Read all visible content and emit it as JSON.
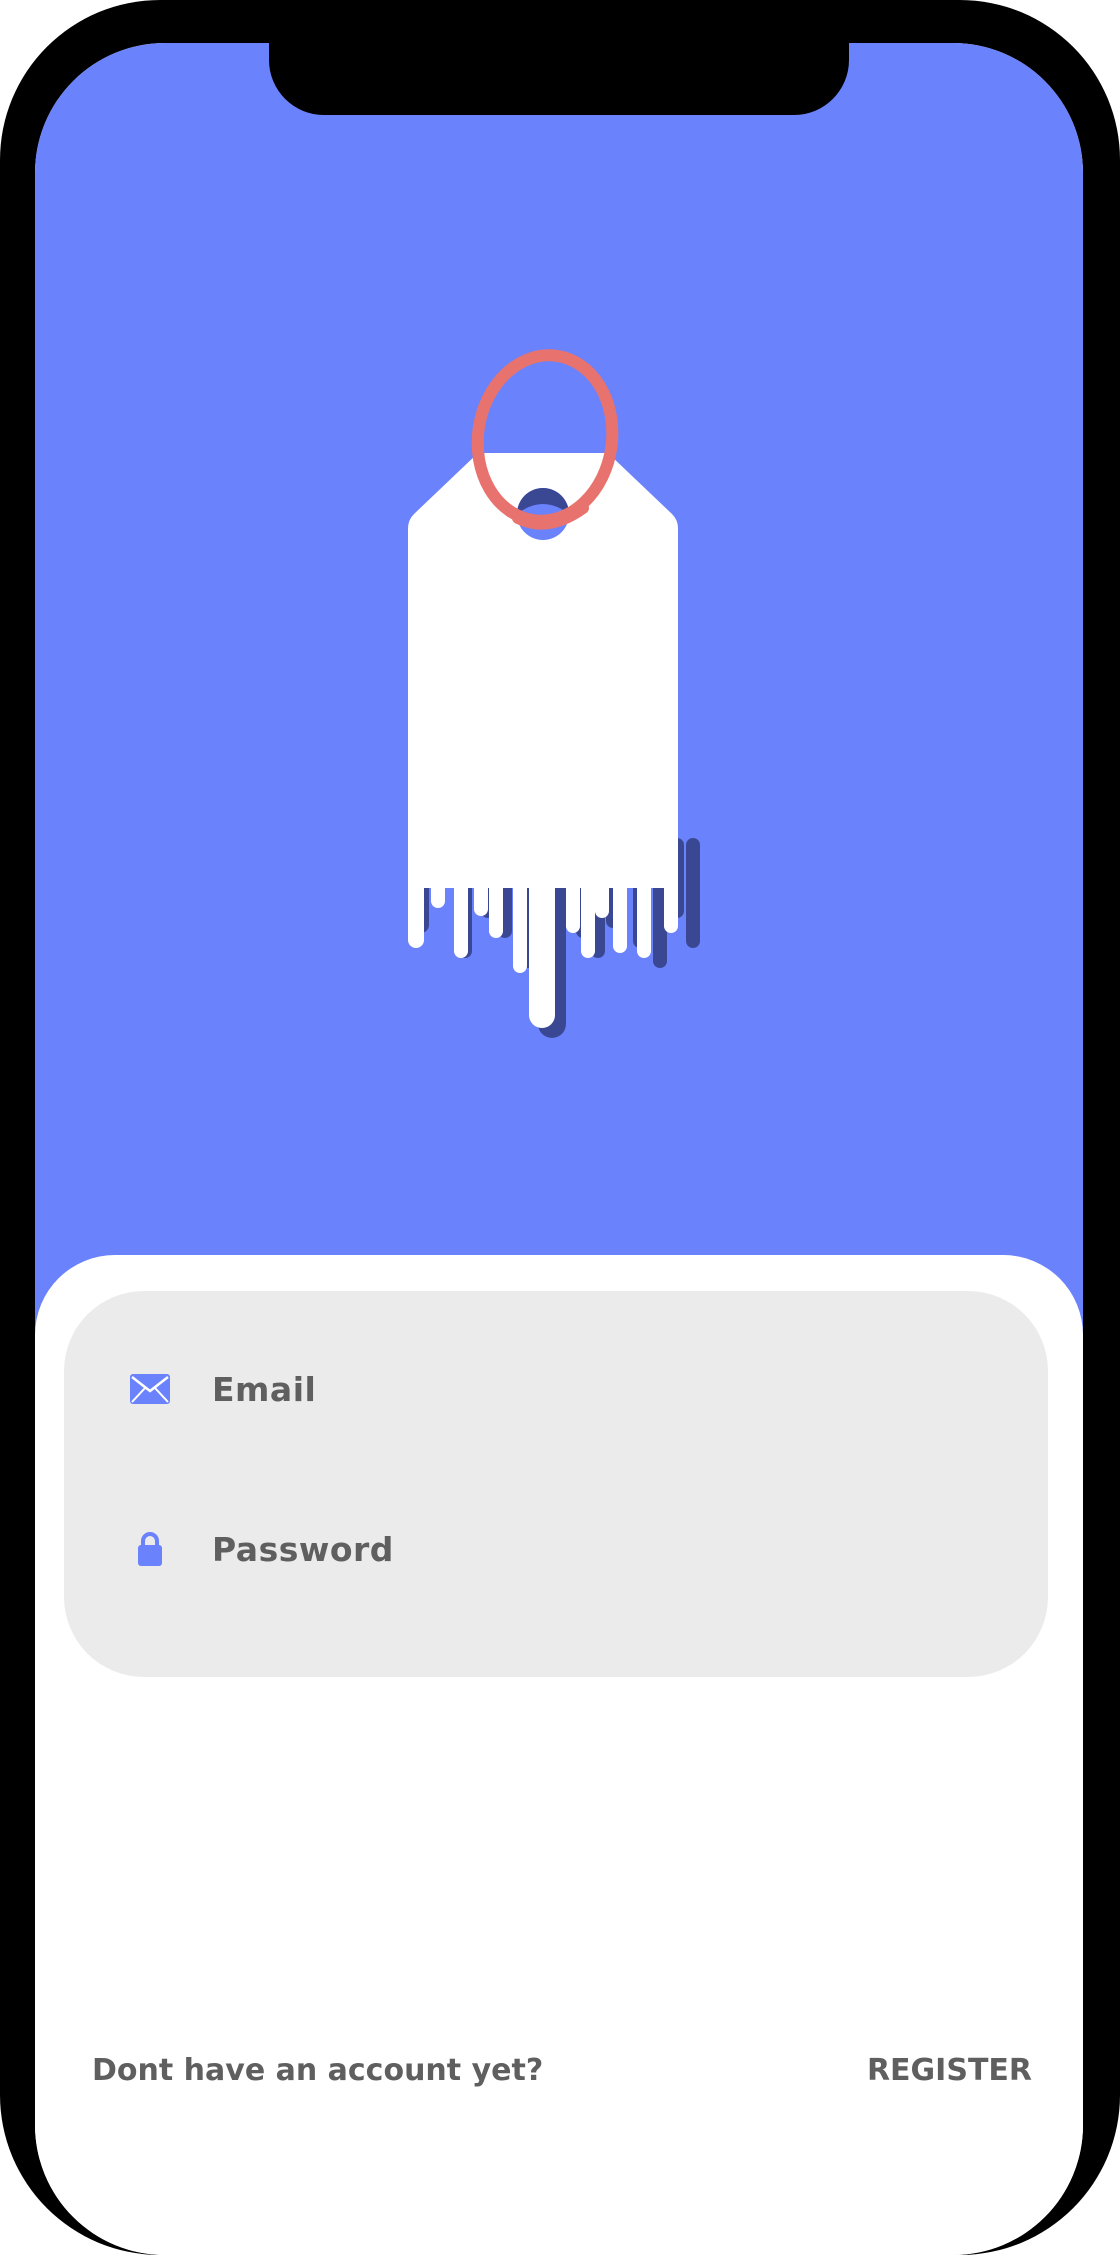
{
  "colors": {
    "accent": "#6a82fb",
    "tag_shadow": "#3a4894",
    "ring": "#e8736e",
    "panel": "#ebebeb",
    "text": "#5f5f5f"
  },
  "hero": {
    "illustration": "price-tag-icon"
  },
  "login": {
    "email": {
      "placeholder": "Email",
      "icon": "envelope-icon"
    },
    "password": {
      "placeholder": "Password",
      "icon": "lock-icon"
    }
  },
  "footer": {
    "prompt": "Dont have an account yet?",
    "register_label": "REGISTER"
  }
}
